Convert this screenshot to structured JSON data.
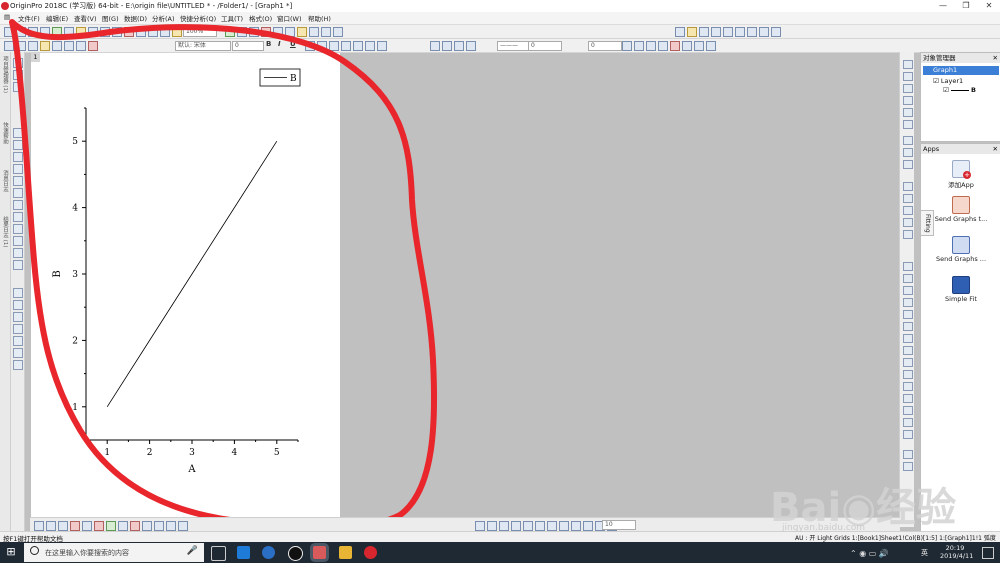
{
  "window": {
    "title": "OriginPro 2018C (学习版) 64-bit - E:\\origin file\\UNTITLED * - /Folder1/ - [Graph1 *]",
    "controls": [
      "—",
      "❐",
      "✕"
    ]
  },
  "menu": [
    "文件(F)",
    "编辑(E)",
    "查看(V)",
    "图(G)",
    "数据(D)",
    "分析(A)",
    "快捷分析(Q)",
    "工具(T)",
    "格式(O)",
    "窗口(W)",
    "帮助(H)"
  ],
  "format_toolbar": {
    "zoom": "100%",
    "font": "默认: 宋体",
    "font_size": "0",
    "bold": "B",
    "italic": "I",
    "underline": "U",
    "line_width": "0",
    "size_field": "0"
  },
  "left_tabs": [
    "项目管理器 (1)",
    "快速帮助",
    "消息日志",
    "结果日志 (1)"
  ],
  "graph": {
    "page_number": "1",
    "legend_label": "B",
    "chart_data": {
      "type": "line",
      "x": [
        1,
        2,
        3,
        4,
        5
      ],
      "series": [
        {
          "name": "B",
          "values": [
            1,
            2,
            3,
            4,
            5
          ]
        }
      ],
      "xlabel": "A",
      "ylabel": "B",
      "x_ticks": [
        "1",
        "2",
        "3",
        "4",
        "5"
      ],
      "y_ticks": [
        "1",
        "2",
        "3",
        "4",
        "5"
      ],
      "xlim": [
        0.5,
        5.5
      ],
      "ylim": [
        0.5,
        5.5
      ],
      "grid": false,
      "legend": "top-right",
      "line_color": "#000000"
    }
  },
  "object_manager": {
    "title": "对象管理器",
    "items": [
      "Graph1",
      "Layer1",
      "B"
    ]
  },
  "apps_panel": {
    "title": "Apps",
    "side_tab": "Fitting",
    "items": [
      {
        "label": "添加App",
        "icon": "add-app-icon"
      },
      {
        "label": "Send Graphs t...",
        "icon": "send-graphs-icon"
      },
      {
        "label": "Send Graphs ...",
        "icon": "send-graphs-word-icon"
      },
      {
        "label": "Simple Fit",
        "icon": "simple-fit-icon"
      }
    ]
  },
  "bottom_toolbar": {
    "size_field": "10"
  },
  "status_bar": {
    "help": "按F1键打开帮助文档",
    "info": "AU : 开  Light Grids  1:[Book1]Sheet1!Col(B)[1:5]  1:[Graph1]1!1  弧度"
  },
  "taskbar": {
    "search_placeholder": "在这里输入你要搜索的内容",
    "time": "20:19",
    "date": "2019/4/11",
    "ime": "英"
  },
  "watermark": {
    "text": "Bai◉经验",
    "url": "jingyan.baidu.com"
  },
  "colors": {
    "annotation": "#e8262b",
    "accent": "#0078d7",
    "taskbar": "#1f2933"
  }
}
